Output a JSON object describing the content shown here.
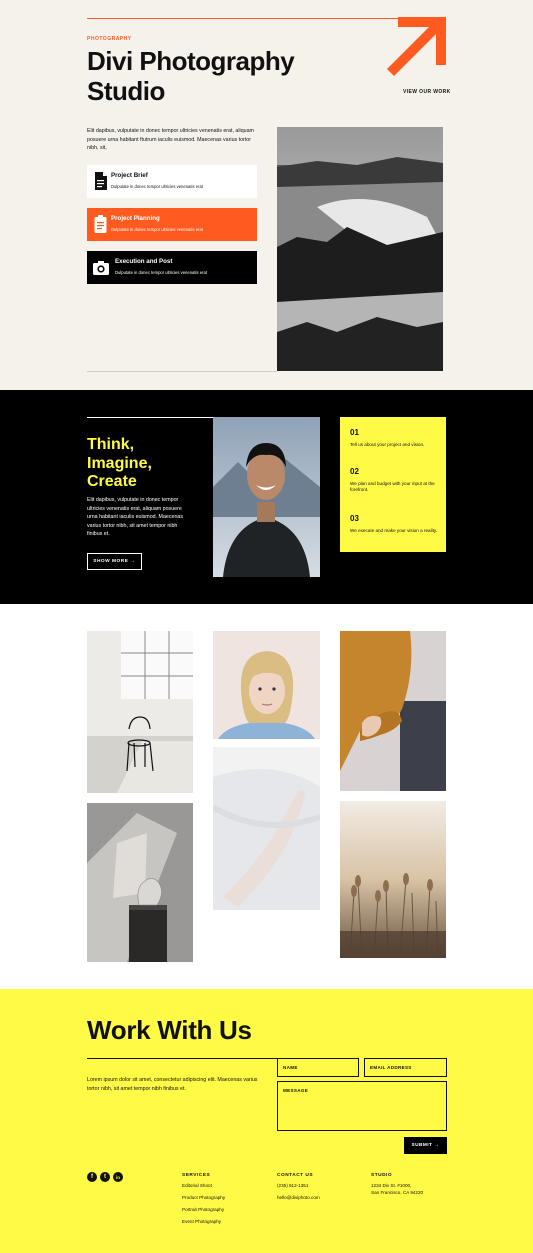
{
  "hero": {
    "eyebrow": "PHOTOGRAPHY",
    "title_line1": "Divi Photography",
    "title_line2": "Studio",
    "view_work": "VIEW OUR WORK",
    "intro": "Elit dapibus, vulputate in donec tempor ultricies venenatis erat, aliquam posuere urna habitant ftutrum iaculis euismod. Maecenas varius tortor nibh, sit,",
    "cards": [
      {
        "title": "Project Brief",
        "desc": "Dulputate in donec tempor ultricies venenatis erat",
        "icon": "document-icon"
      },
      {
        "title": "Project Planning",
        "desc": "Dulputate in donec tempor ultricies venenatis erat",
        "icon": "clipboard-icon"
      },
      {
        "title": "Execution and Post",
        "desc": "Dulputate in donec tempor ultricies venenatis erat",
        "icon": "camera-icon"
      }
    ]
  },
  "dark": {
    "heading_l1": "Think,",
    "heading_l2": "Imagine,",
    "heading_l3": "Create",
    "body": "Elit dapibus, vulputate in donec tempor ultricies venenatis erat, aliquam posuere urna habitant iaculis euismod. Maecenas varius tortor nibh, sit amet tempor nibh finibus et.",
    "button": "SHOW MORE",
    "steps": [
      {
        "num": "01",
        "text": "Tell us about your project and vision."
      },
      {
        "num": "02",
        "text": "We plan and budget with your input at the forefront."
      },
      {
        "num": "03",
        "text": "We execute and make your vision a reality."
      }
    ]
  },
  "contact": {
    "title": "Work With Us",
    "body": "Lorem ipsum dolor sit amet, consectetur adipiscing elit. Maecenas varius tortor nibh, sit amet tempor nibh finibus et.",
    "name_label": "NAME",
    "email_label": "EMAIL ADDRESS",
    "message_label": "MESSAGE",
    "submit": "SUBMIT",
    "social": [
      "f",
      "t",
      "in"
    ],
    "services_title": "SERVICES",
    "services": [
      "Editorial Shoot",
      "Product Photography",
      "Portrait Photography",
      "Event Photography"
    ],
    "contact_title": "CONTACT US",
    "phone": "(235) 912-1351",
    "email": "hello@diviphoto.com",
    "studio_title": "STUDIO",
    "address_l1": "1234 Div St. #1000,",
    "address_l2": "San Francisco, CA 94220"
  },
  "colors": {
    "accent_orange": "#ff5a1f",
    "accent_yellow": "#fffa45",
    "hero_bg": "#f5f2ec",
    "dark_bg": "#000000"
  }
}
